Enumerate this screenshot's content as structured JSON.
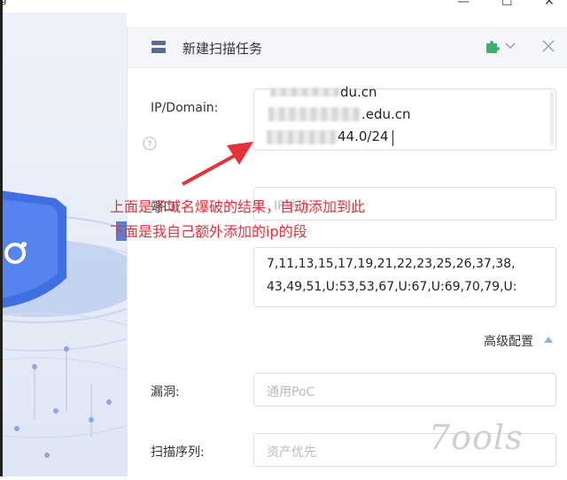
{
  "window": {
    "minimize_symbol": "—",
    "maximize_symbol": "☐",
    "close_symbol": "✕"
  },
  "dialog": {
    "title": "新建扫描任务",
    "title_icon": "task-icon",
    "plugin_icon": "puzzle-icon",
    "dropdown_icon": "chevron-down-icon",
    "close_icon": "close-icon"
  },
  "form": {
    "target_label": "IP/Domain:",
    "target_lines": [
      "du.cn",
      ".edu.cn",
      "44.0/24"
    ],
    "help_icon": "question-icon",
    "port_label": "端口:",
    "port_placeholder": "IP地址",
    "ports_value_line1": "7,11,13,15,17,19,21,22,23,25,26,37,38,",
    "ports_value_line2": "43,49,51,U:53,53,67,U:67,U:69,70,79,U:",
    "advanced_label": "高级配置",
    "vuln_label": "漏洞:",
    "vuln_placeholder": "通用PoC",
    "scan_order_label": "扫描序列:",
    "scan_order_placeholder": "资产优先"
  },
  "annotation": {
    "line1": "上面是子域名爆破的结果，自动添加到此",
    "line2": "下面是我自己额外添加的ip的段",
    "color": "#e8303a"
  },
  "watermark": "7ools"
}
